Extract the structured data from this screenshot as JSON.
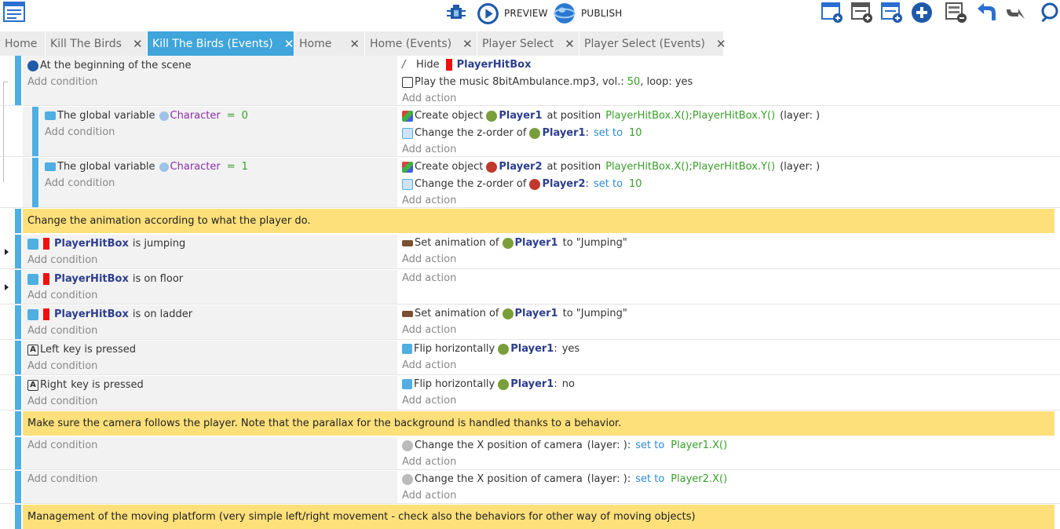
{
  "toolbar": {
    "preview_label": "PREVIEW",
    "publish_label": "PUBLISH"
  },
  "tabs": [
    {
      "label": "Home",
      "closable": false
    },
    {
      "label": "Kill The Birds",
      "closable": true
    },
    {
      "label": "Kill The Birds (Events)",
      "closable": true,
      "active": true
    },
    {
      "label": "Home",
      "closable": true
    },
    {
      "label": "Home (Events)",
      "closable": true
    },
    {
      "label": "Player Select",
      "closable": true
    },
    {
      "label": "Player Select (Events)",
      "closable": true
    }
  ],
  "close_glyph": "✕",
  "add_condition": "Add condition",
  "add_action": "Add action",
  "events": {
    "e1": {
      "cond": "At the beginning of the scene",
      "a1_verb": "Hide",
      "a1_obj": "PlayerHitBox",
      "a2_pre": "Play the music",
      "a2_file": "8bitAmbulance.mp3, vol.:",
      "a2_vol": "50",
      "a2_post": ", loop: yes"
    },
    "e2": {
      "cond_pre": "The global variable",
      "cond_var": "Character",
      "cond_op": "=",
      "cond_val": "0",
      "a1_pre": "Create object",
      "a1_obj": "Player1",
      "a1_mid": "at position",
      "a1_expr": "PlayerHitBox.X();PlayerHitBox.Y()",
      "a1_post": "(layer: )",
      "a2_pre": "Change the z-order of",
      "a2_obj": "Player1",
      "a2_kw": "set to",
      "a2_val": "10"
    },
    "e3": {
      "cond_pre": "The global variable",
      "cond_var": "Character",
      "cond_op": "=",
      "cond_val": "1",
      "a1_pre": "Create object",
      "a1_obj": "Player2",
      "a1_mid": "at position",
      "a1_expr": "PlayerHitBox.X();PlayerHitBox.Y()",
      "a1_post": "(layer: )",
      "a2_pre": "Change the z-order of",
      "a2_obj": "Player2",
      "a2_kw": "set to",
      "a2_val": "10"
    },
    "c1": "Change the animation according to what the player do.",
    "e4": {
      "obj": "PlayerHitBox",
      "cond": "is jumping",
      "a_pre": "Set animation of",
      "a_obj": "Player1",
      "a_post": "to \"Jumping\""
    },
    "e5": {
      "obj": "PlayerHitBox",
      "cond": "is on floor"
    },
    "e6": {
      "obj": "PlayerHitBox",
      "cond": "is on ladder",
      "a_pre": "Set animation of",
      "a_obj": "Player1",
      "a_post": "to \"Jumping\""
    },
    "e7": {
      "key": "Left",
      "cond": "key is pressed",
      "a_pre": "Flip horizontally",
      "a_obj": "Player1",
      "a_post": "yes"
    },
    "e8": {
      "key": "Right",
      "cond": "key is pressed",
      "a_pre": "Flip horizontally",
      "a_obj": "Player1",
      "a_post": "no"
    },
    "c2": "Make sure the camera follows the player. Note that the parallax for the background is handled thanks to a behavior.",
    "e9": {
      "a_pre": "Change the X position of camera",
      "a_layer": "(layer: ):",
      "a_kw": "set to",
      "a_expr": "Player1.X()"
    },
    "e10": {
      "a_pre": "Change the X position of camera",
      "a_layer": "(layer: ):",
      "a_kw": "set to",
      "a_expr": "Player2.X()"
    },
    "c3": "Management of the moving platform (very simple left/right movement - check also the behaviors for other way of moving objects)"
  }
}
